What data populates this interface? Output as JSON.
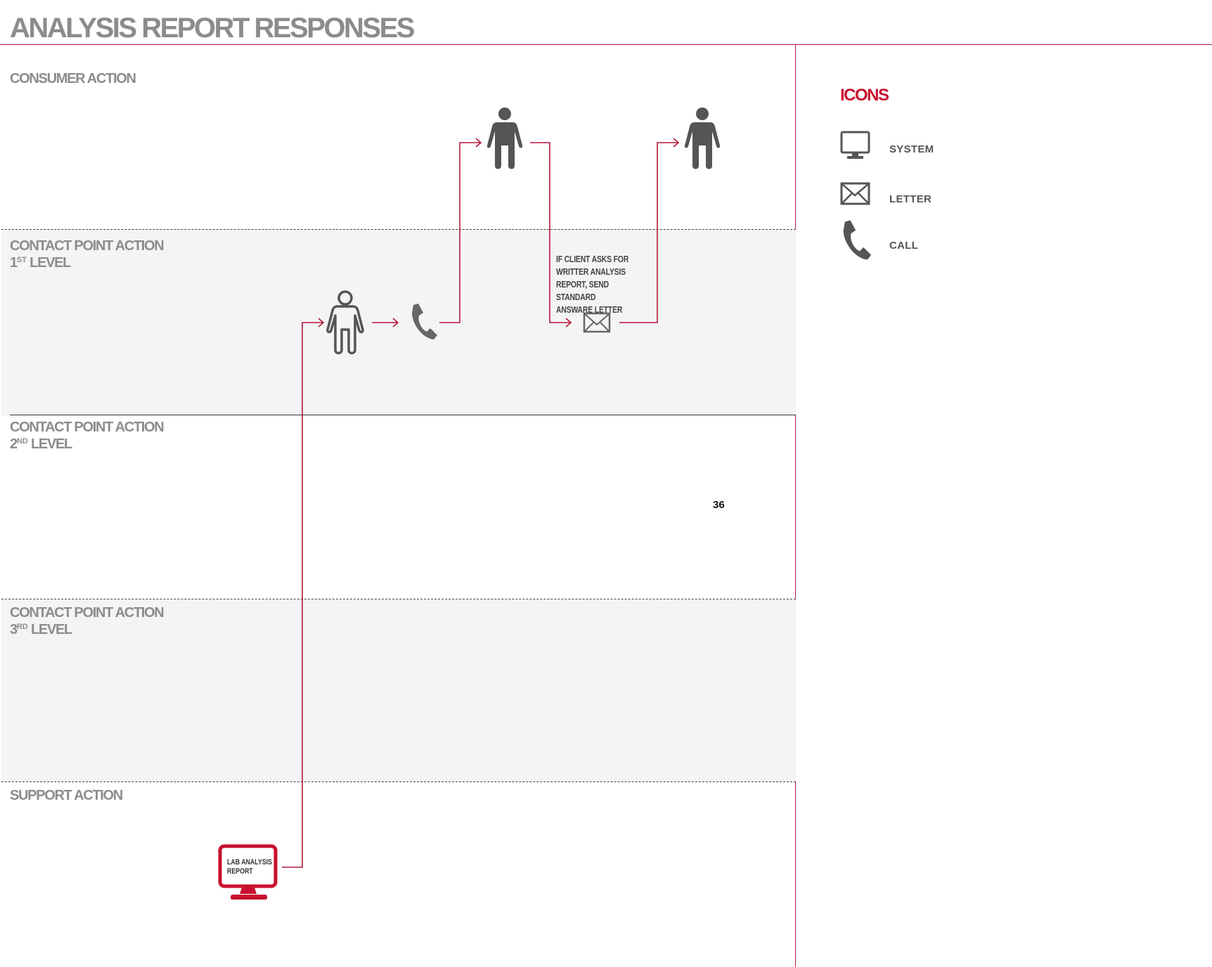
{
  "page": {
    "title": "ANALYSIS REPORT RESPONSES",
    "page_number": "36",
    "accent_color": "#c8102e",
    "icon_color": "#555555"
  },
  "lanes": [
    {
      "id": "consumer",
      "label_line1": "CONSUMER ACTION",
      "label_line2_num": "",
      "label_line2_sup": "",
      "label_line2_rest": "",
      "shaded": false
    },
    {
      "id": "cp1",
      "label_line1": "CONTACT POINT ACTION",
      "label_line2_num": "1",
      "label_line2_sup": "ST",
      "label_line2_rest": " LEVEL",
      "shaded": true
    },
    {
      "id": "cp2",
      "label_line1": "CONTACT POINT ACTION",
      "label_line2_num": "2",
      "label_line2_sup": "ND",
      "label_line2_rest": " LEVEL",
      "shaded": false
    },
    {
      "id": "cp3",
      "label_line1": "CONTACT POINT ACTION",
      "label_line2_num": "3",
      "label_line2_sup": "RD",
      "label_line2_rest": " LEVEL",
      "shaded": true
    },
    {
      "id": "support",
      "label_line1": "SUPPORT ACTION",
      "label_line2_num": "",
      "label_line2_sup": "",
      "label_line2_rest": "",
      "shaded": false
    }
  ],
  "nodes": {
    "lab_report": {
      "icon": "monitor-icon",
      "text": "LAB ANALYSIS\nREPORT",
      "lane": "support"
    },
    "contact_person": {
      "icon": "person-outline-icon",
      "lane": "cp1"
    },
    "call": {
      "icon": "phone-icon",
      "lane": "cp1"
    },
    "consumer_1": {
      "icon": "person-filled-icon",
      "lane": "consumer"
    },
    "letter": {
      "icon": "envelope-icon",
      "lane": "cp1"
    },
    "consumer_2": {
      "icon": "person-filled-icon",
      "lane": "consumer"
    }
  },
  "note": "IF CLIENT ASKS FOR\nWRITTER ANALYSIS\nREPORT, SEND STANDARD\nANSWARE LETTER",
  "legend": {
    "title": "ICONS",
    "items": [
      {
        "icon": "monitor-icon",
        "label": "SYSTEM"
      },
      {
        "icon": "envelope-icon",
        "label": "LETTER"
      },
      {
        "icon": "phone-icon",
        "label": "CALL"
      }
    ]
  }
}
